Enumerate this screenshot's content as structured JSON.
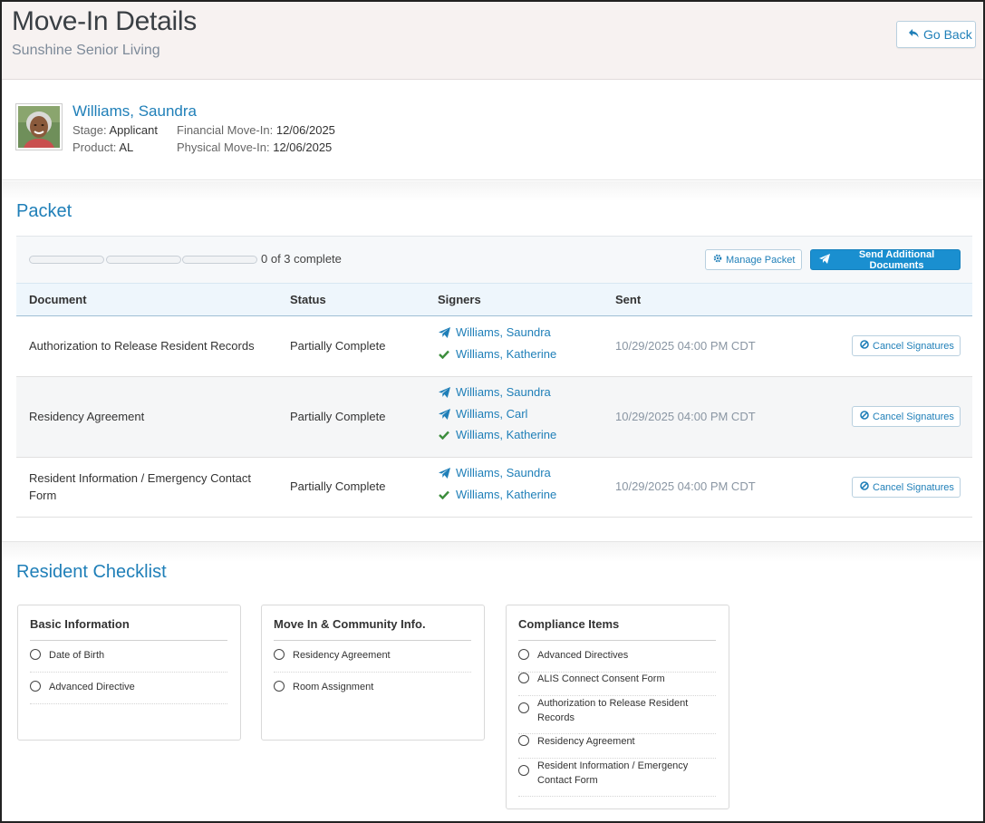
{
  "header": {
    "title": "Move-In Details",
    "subtitle": "Sunshine Senior Living",
    "go_back_label": "Go Back"
  },
  "resident": {
    "name": "Williams, Saundra",
    "stage_label": "Stage:",
    "stage": "Applicant",
    "product_label": "Product:",
    "product": "AL",
    "financial_label": "Financial Move-In:",
    "financial_date": "12/06/2025",
    "physical_label": "Physical Move-In:",
    "physical_date": "12/06/2025"
  },
  "packet": {
    "title": "Packet",
    "progress_text": "0 of 3 complete",
    "progress": {
      "completed": 0,
      "total": 3
    },
    "manage_label": "Manage Packet",
    "send_label": "Send Additional Documents",
    "columns": [
      "Document",
      "Status",
      "Signers",
      "Sent"
    ],
    "rows": [
      {
        "document": "Authorization to Release Resident Records",
        "status": "Partially Complete",
        "signers": [
          {
            "name": "Williams, Saundra",
            "icon": "paper-plane-icon"
          },
          {
            "name": "Williams, Katherine",
            "icon": "check-icon"
          }
        ],
        "sent": "10/29/2025 04:00 PM CDT",
        "action": "Cancel Signatures"
      },
      {
        "document": "Residency Agreement",
        "status": "Partially Complete",
        "signers": [
          {
            "name": "Williams, Saundra",
            "icon": "paper-plane-icon"
          },
          {
            "name": "Williams, Carl",
            "icon": "paper-plane-icon"
          },
          {
            "name": "Williams, Katherine",
            "icon": "check-icon"
          }
        ],
        "sent": "10/29/2025 04:00 PM CDT",
        "action": "Cancel Signatures"
      },
      {
        "document": "Resident Information / Emergency Contact Form",
        "status": "Partially Complete",
        "signers": [
          {
            "name": "Williams, Saundra",
            "icon": "paper-plane-icon"
          },
          {
            "name": "Williams, Katherine",
            "icon": "check-icon"
          }
        ],
        "sent": "10/29/2025 04:00 PM CDT",
        "action": "Cancel Signatures"
      }
    ]
  },
  "checklist": {
    "title": "Resident Checklist",
    "groups": [
      {
        "title": "Basic Information",
        "items": [
          "Date of Birth",
          "Advanced Directive"
        ]
      },
      {
        "title": "Move In & Community Info.",
        "items": [
          "Residency Agreement",
          "Room Assignment"
        ]
      },
      {
        "title": "Compliance Items",
        "items": [
          "Advanced Directives",
          "ALIS Connect Consent Form",
          "Authorization to Release Resident Records",
          "Residency Agreement",
          "Resident Information / Emergency Contact Form"
        ]
      }
    ]
  },
  "colors": {
    "accent": "#1f7fb8",
    "primary_button": "#1a8fd0",
    "check": "#3c8d3c",
    "header_bg": "#f7f2f1"
  }
}
